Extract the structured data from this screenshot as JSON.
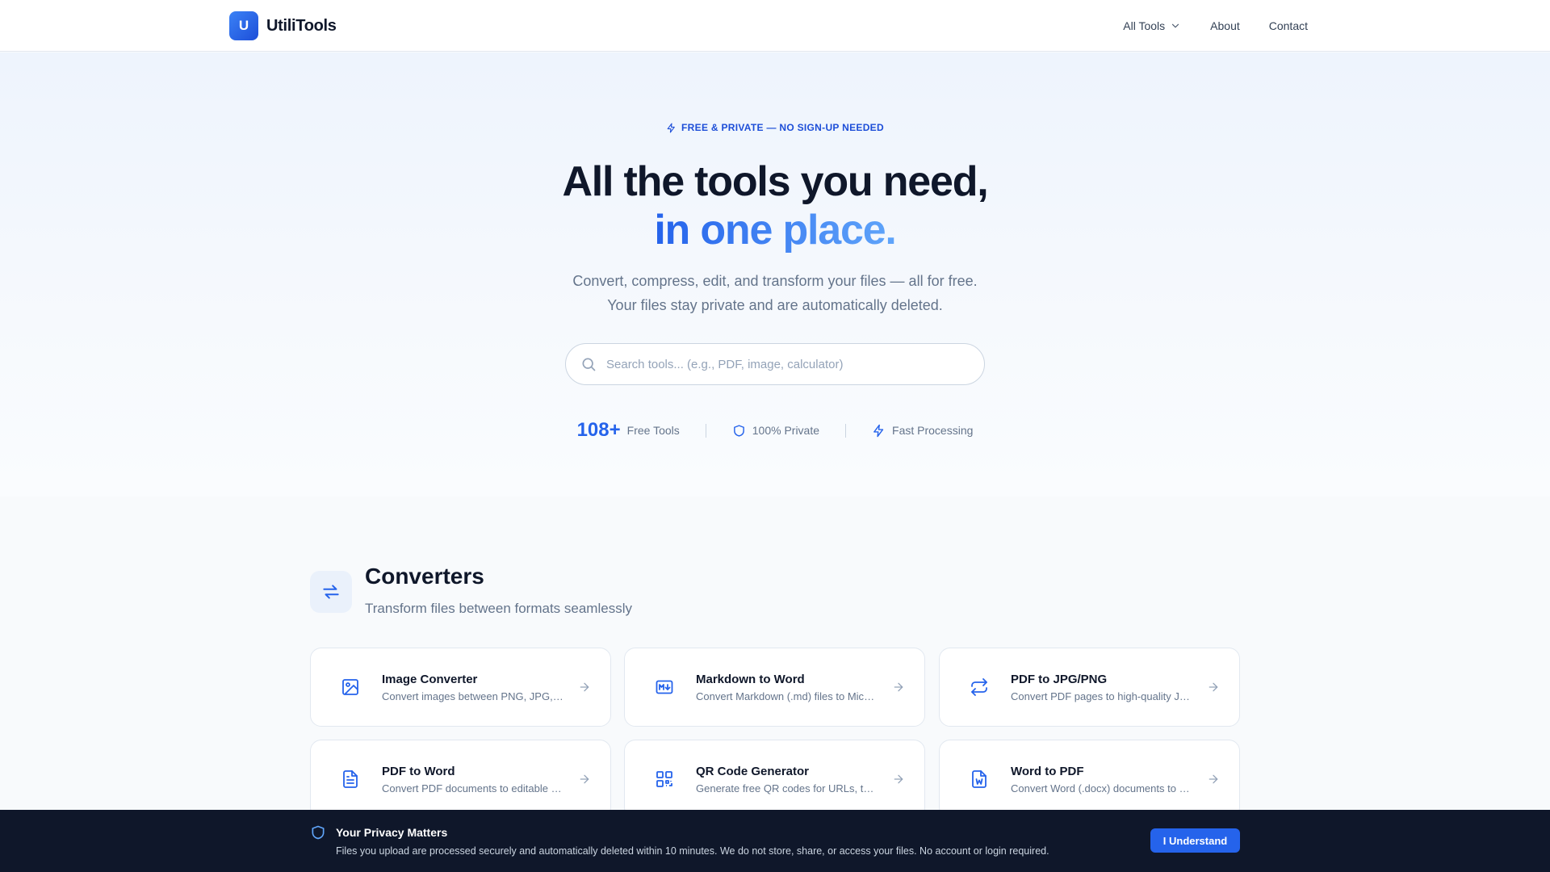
{
  "header": {
    "logo_letter": "U",
    "brand": "UtiliTools",
    "nav": {
      "all_tools": "All Tools",
      "about": "About",
      "contact": "Contact"
    }
  },
  "hero": {
    "badge": "FREE & PRIVATE — NO SIGN-UP NEEDED",
    "headline_line1": "All the tools you need,",
    "headline_line2": "in one place.",
    "subtitle_line1": "Convert, compress, edit, and transform your files — all for free.",
    "subtitle_line2": "Your files stay private and are automatically deleted.",
    "search_placeholder": "Search tools... (e.g., PDF, image, calculator)",
    "stats": {
      "tools_count": "108+",
      "tools_label": "Free Tools",
      "private_label": "100% Private",
      "fast_label": "Fast Processing"
    }
  },
  "section": {
    "title": "Converters",
    "subtitle": "Transform files between formats seamlessly",
    "cards": [
      {
        "title": "Image Converter",
        "desc": "Convert images between PNG, JPG, WEBP and more formats",
        "icon": "image-icon"
      },
      {
        "title": "Markdown to Word",
        "desc": "Convert Markdown (.md) files to Microsoft Word documents",
        "icon": "markdown-icon"
      },
      {
        "title": "PDF to JPG/PNG",
        "desc": "Convert PDF pages to high-quality JPG or PNG images",
        "icon": "convert-arrows-icon"
      },
      {
        "title": "PDF to Word",
        "desc": "Convert PDF documents to editable Word files",
        "icon": "document-icon"
      },
      {
        "title": "QR Code Generator",
        "desc": "Generate free QR codes for URLs, text and more",
        "icon": "qr-code-icon"
      },
      {
        "title": "Word to PDF",
        "desc": "Convert Word (.docx) documents to PDF files",
        "icon": "word-file-icon"
      }
    ]
  },
  "privacy": {
    "title": "Your Privacy Matters",
    "text": "Files you upload are processed securely and automatically deleted within 10 minutes. We do not store, share, or access your files. No account or login required.",
    "button": "I Understand"
  },
  "colors": {
    "accent": "#2563eb",
    "banner": "#0f172a"
  }
}
